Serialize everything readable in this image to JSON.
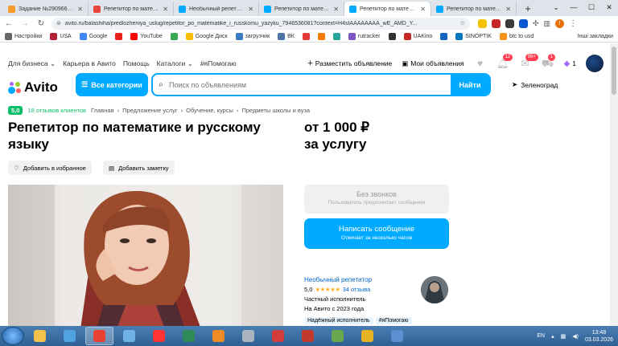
{
  "browser": {
    "tabs": [
      {
        "title": "Задание №2909663 - ...",
        "favicon_color": "#f59b2b",
        "fav_text": "SP"
      },
      {
        "title": "Репетитор по матема...",
        "favicon_color": "#e8453c"
      },
      {
        "title": "Необычный репетитор",
        "favicon_color": "#00aaff"
      },
      {
        "title": "Репетитор по матема...",
        "favicon_color": "#00aaff"
      },
      {
        "title": "Репетитор по матема...",
        "favicon_color": "#00aaff",
        "active": true
      },
      {
        "title": "Репетитор по матема...",
        "favicon_color": "#00aaff"
      }
    ],
    "url": "avito.ru/balashiha/predlozheniya_uslug/repetitor_po_matematike_i_russkomu_yazyku_7946536081?context=H4sIAAAAAAAA_wE_AMD_Y...",
    "bookmarks": [
      {
        "label": "Настройки",
        "color": "#666"
      },
      {
        "label": "USA",
        "color": "#b22234"
      },
      {
        "label": "Google",
        "color": "#4285f4"
      },
      {
        "label": "",
        "color": "#e62117"
      },
      {
        "label": "YouTube",
        "color": "#ff0000"
      },
      {
        "label": "",
        "color": "#34a853"
      },
      {
        "label": "Google Диск",
        "color": "#fbbc04"
      },
      {
        "label": "загрузчик",
        "color": "#3b7bbf"
      },
      {
        "label": "ВК",
        "color": "#4a76a8"
      },
      {
        "label": "",
        "color": "#e53935"
      },
      {
        "label": "",
        "color": "#f57c00"
      },
      {
        "label": "",
        "color": "#26a69a"
      },
      {
        "label": "rutracker",
        "color": "#7e57c2"
      },
      {
        "label": "",
        "color": "#333"
      },
      {
        "label": "UAKino",
        "color": "#c62828"
      },
      {
        "label": "",
        "color": "#1565c0"
      },
      {
        "label": "SINOPTIK",
        "color": "#0277bd"
      },
      {
        "label": "btc to usd",
        "color": "#f7931a"
      }
    ],
    "bookmarks_other": "Інші закладки"
  },
  "site": {
    "nav": {
      "business": "Для бизнеса",
      "career": "Карьера в Авито",
      "help": "Помощь",
      "catalogs": "Каталоги",
      "helping": "#яПомогаю"
    },
    "post_ad": "Разместить объявление",
    "my_ads": "Мои объявления",
    "badges": {
      "notifications": "12",
      "messages": "99+",
      "cart": "1"
    },
    "wallet_count": "1",
    "logo": "Avito",
    "categories_button": "Все категории",
    "search": {
      "placeholder": "Поиск по объявлениям",
      "button": "Найти"
    },
    "location": "Зеленоград"
  },
  "listing": {
    "rating": "5,0",
    "reviews": "18 отзывов клиентов",
    "breadcrumbs": [
      "Главная",
      "Предложение услуг",
      "Обучение, курсы",
      "Предметы школы и вуза"
    ],
    "title": "Репетитор по математике и русскому языку",
    "price_line1": "от 1 000 ₽",
    "price_line2": "за услугу",
    "add_favorite": "Добавить в избранное",
    "add_note": "Добавить заметку",
    "call": {
      "label": "Без звонков",
      "sub": "Пользователь предпочитает сообщения"
    },
    "message": {
      "label": "Написать сообщение",
      "sub": "Отвечает за несколько часов"
    },
    "seller": {
      "name": "Необычный репетитор",
      "rating": "5,0",
      "stars": "★★★★★",
      "reviews": "34 отзыва",
      "type": "Частный исполнитель",
      "since": "На Авито с 2023 года",
      "tags": [
        "Надёжный исполнитель",
        "#яПомогаю"
      ]
    }
  },
  "taskbar": {
    "apps": [
      {
        "name": "explorer",
        "color": "#f3c24a"
      },
      {
        "name": "wm",
        "color": "#4fa3e0"
      },
      {
        "name": "chrome",
        "color": "#e94235",
        "active": true
      },
      {
        "name": "network",
        "color": "#6fb3e6"
      },
      {
        "name": "yandex",
        "color": "#ff3333"
      },
      {
        "name": "media",
        "color": "#2e8b57"
      },
      {
        "name": "player",
        "color": "#f08a24"
      },
      {
        "name": "vpn",
        "color": "#aab4c0"
      },
      {
        "name": "antivirus",
        "color": "#d23c3c"
      },
      {
        "name": "64",
        "color": "#c0392b"
      },
      {
        "name": "paint",
        "color": "#6aa84f"
      },
      {
        "name": "files",
        "color": "#e6b422"
      },
      {
        "name": "monitor",
        "color": "#5a8fd0"
      }
    ],
    "lang": "EN",
    "time": "13:48",
    "date": "03.03.2026"
  }
}
